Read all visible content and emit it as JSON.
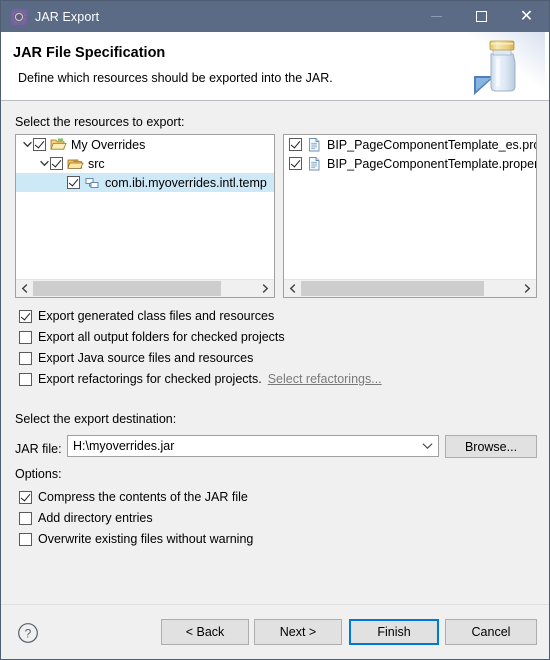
{
  "window": {
    "title": "JAR Export",
    "icon": "gear-icon",
    "controls": {
      "minimize": "minimize-icon",
      "maximize": "maximize-icon",
      "close": "close-icon"
    }
  },
  "header": {
    "title": "JAR File Specification",
    "subtitle": "Define which resources should be exported into the JAR.",
    "art": "jar-illustration"
  },
  "resources": {
    "label": "Select the resources to export:",
    "tree": [
      {
        "label": "My Overrides",
        "checked": true,
        "expanded": true,
        "indent": 0,
        "icon": "open-folder-icon",
        "selected": false
      },
      {
        "label": "src",
        "checked": true,
        "expanded": true,
        "indent": 1,
        "icon": "source-folder-icon",
        "selected": false
      },
      {
        "label": "com.ibi.myoverrides.intl.temp",
        "checked": true,
        "expanded": null,
        "indent": 2,
        "icon": "package-icon",
        "selected": true
      }
    ],
    "files": [
      {
        "label": "BIP_PageComponentTemplate_es.proper",
        "checked": true,
        "icon": "file-icon"
      },
      {
        "label": "BIP_PageComponentTemplate.properties",
        "checked": true,
        "icon": "file-icon"
      }
    ],
    "scroll_left_icon": "scroll-left-icon",
    "scroll_right_icon": "scroll-right-icon"
  },
  "export_options": [
    {
      "label": "Export generated class files and resources",
      "checked": true
    },
    {
      "label": "Export all output folders for checked projects",
      "checked": false
    },
    {
      "label": "Export Java source files and resources",
      "checked": false
    },
    {
      "label": "Export refactorings for checked projects.",
      "checked": false,
      "link": "Select refactorings..."
    }
  ],
  "destination": {
    "label": "Select the export destination:",
    "jar_file_label": "JAR file:",
    "jar_file_value": "H:\\myoverrides.jar",
    "browse_label": "Browse...",
    "chevron": "chevron-down-icon"
  },
  "options": {
    "label": "Options:",
    "items": [
      {
        "label": "Compress the contents of the JAR file",
        "checked": true
      },
      {
        "label": "Add directory entries",
        "checked": false
      },
      {
        "label": "Overwrite existing files without warning",
        "checked": false
      }
    ]
  },
  "footer": {
    "help_icon": "help-icon",
    "back_label": "< Back",
    "next_label": "Next >",
    "finish_label": "Finish",
    "cancel_label": "Cancel",
    "focused_button": "Finish"
  },
  "colors": {
    "titlebar": "#5b6b85",
    "accent": "#0078d7",
    "selection": "#cde8f7",
    "dialog_bg": "#f0f0f0"
  }
}
